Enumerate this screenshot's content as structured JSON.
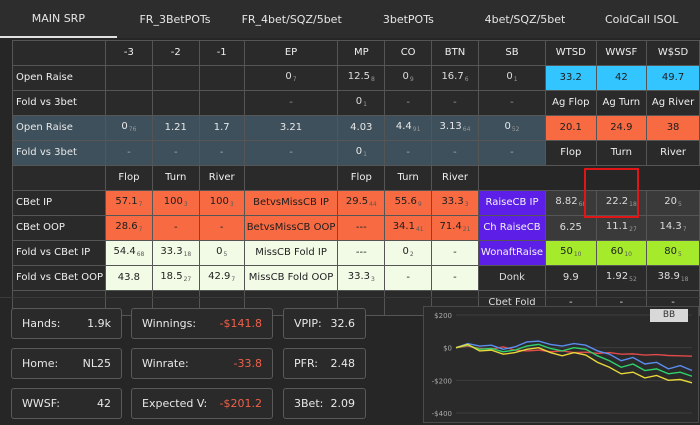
{
  "tabs": [
    "MAIN SRP",
    "FR_3BetPOTs",
    "FR_4bet/SQZ/5bet",
    "3betPOTs",
    "4bet/SQZ/5bet",
    "ColdCall ISOL"
  ],
  "positions_header": [
    "-3",
    "-2",
    "-1",
    "EP",
    "MP",
    "CO",
    "BTN",
    "SB"
  ],
  "showdown_header": [
    "WTSD",
    "WWSF",
    "W$SD"
  ],
  "showdown_values": [
    "33.2",
    "42",
    "49.7"
  ],
  "rows_top": [
    {
      "label": "Open Raise",
      "cells": [
        {
          "v": ""
        },
        {
          "v": ""
        },
        {
          "v": ""
        },
        {
          "v": "0",
          "s": "7"
        },
        {
          "v": "12.5",
          "s": "8"
        },
        {
          "v": "0",
          "s": "9"
        },
        {
          "v": "16.7",
          "s": "6"
        },
        {
          "v": "0",
          "s": "1"
        }
      ]
    },
    {
      "label": "Fold vs 3bet",
      "cells": [
        {
          "v": ""
        },
        {
          "v": ""
        },
        {
          "v": ""
        },
        {
          "v": "-"
        },
        {
          "v": "0",
          "s": "1"
        },
        {
          "v": "-"
        },
        {
          "v": "-"
        },
        {
          "v": "-"
        }
      ]
    },
    {
      "label": "Open Raise",
      "cells": [
        {
          "v": "0",
          "s": "76"
        },
        {
          "v": "1.21"
        },
        {
          "v": "1.7"
        },
        {
          "v": "3.21"
        },
        {
          "v": "4.03"
        },
        {
          "v": "4.4",
          "s": "91"
        },
        {
          "v": "3.13",
          "s": "64"
        },
        {
          "v": "0",
          "s": "52"
        }
      ]
    },
    {
      "label": "Fold vs 3bet",
      "cells": [
        {
          "v": "-"
        },
        {
          "v": "-"
        },
        {
          "v": "-"
        },
        {
          "v": "-"
        },
        {
          "v": "0",
          "s": "1"
        },
        {
          "v": "-"
        },
        {
          "v": "-"
        },
        {
          "v": "-"
        }
      ]
    }
  ],
  "aggression_header": [
    "Ag Flop",
    "Ag Turn",
    "Ag River"
  ],
  "aggression_values": [
    "20.1",
    "24.9",
    "38"
  ],
  "street_header": [
    "Flop",
    "Turn",
    "River"
  ],
  "cbet_section": {
    "header": [
      "Flop",
      "Turn",
      "River",
      "Flop",
      "Turn",
      "River"
    ],
    "rows": [
      {
        "label": "CBet IP",
        "left": [
          {
            "v": "57.1",
            "s": "7"
          },
          {
            "v": "100",
            "s": "3"
          },
          {
            "v": "100",
            "s": "3"
          }
        ],
        "mid_label": "BetvsMissCB IP",
        "mid": [
          {
            "v": "29.5",
            "s": "44"
          },
          {
            "v": "55.6",
            "s": "9"
          },
          {
            "v": "33.3",
            "s": "3"
          }
        ],
        "right_label": "RaiseCB IP",
        "right": [
          {
            "v": "8.82",
            "s": "68"
          },
          {
            "v": "22.2",
            "s": "18"
          },
          {
            "v": "20",
            "s": "5"
          }
        ]
      },
      {
        "label": "CBet OOP",
        "left": [
          {
            "v": "28.6",
            "s": "7"
          },
          {
            "v": "-"
          },
          {
            "v": "-"
          }
        ],
        "mid_label": "BetvsMissCB OOP",
        "mid": [
          {
            "v": "---"
          },
          {
            "v": "34.1",
            "s": "41"
          },
          {
            "v": "71.4",
            "s": "21"
          }
        ],
        "right_label": "Ch RaiseCB",
        "right": [
          {
            "v": "6.25"
          },
          {
            "v": "11.1",
            "s": "27"
          },
          {
            "v": "14.3",
            "s": "7"
          }
        ]
      },
      {
        "label": "Fold vs CBet IP",
        "left": [
          {
            "v": "54.4",
            "s": "68"
          },
          {
            "v": "33.3",
            "s": "18"
          },
          {
            "v": "0",
            "s": "5"
          }
        ],
        "mid_label": "MissCB Fold IP",
        "mid": [
          {
            "v": "---"
          },
          {
            "v": "0",
            "s": "2"
          },
          {
            "v": "-"
          }
        ],
        "right_label": "WonaftRaise",
        "right": [
          {
            "v": "50",
            "s": "10"
          },
          {
            "v": "60",
            "s": "10"
          },
          {
            "v": "80",
            "s": "5"
          }
        ]
      },
      {
        "label": "Fold vs CBet OOP",
        "left": [
          {
            "v": "43.8"
          },
          {
            "v": "18.5",
            "s": "27"
          },
          {
            "v": "42.9",
            "s": "7"
          }
        ],
        "mid_label": "MissCB Fold OOP",
        "mid": [
          {
            "v": "33.3",
            "s": "3"
          },
          {
            "v": "-"
          },
          {
            "v": "-"
          }
        ],
        "right_label": "Donk",
        "right": [
          {
            "v": "9.9"
          },
          {
            "v": "1.92",
            "s": "52"
          },
          {
            "v": "38.9",
            "s": "18"
          }
        ]
      },
      {
        "label": "",
        "left": [],
        "mid_label": "",
        "mid": [],
        "right_label": "Cbet Fold",
        "right": [
          {
            "v": "-"
          },
          {
            "v": "-"
          },
          {
            "v": "-"
          }
        ]
      }
    ]
  },
  "stats": {
    "hands_label": "Hands:",
    "hands_value": "1.9k",
    "winnings_label": "Winnings:",
    "winnings_value": "-$141.8",
    "vpip_label": "VPIP:",
    "vpip_value": "32.6",
    "home_label": "Home:",
    "home_value": "NL25",
    "winrate_label": "Winrate:",
    "winrate_value": "-33.8",
    "pfr_label": "PFR:",
    "pfr_value": "2.48",
    "wwsf_label": "WWSF:",
    "wwsf_value": "42",
    "ev_label": "Expected V:",
    "ev_value": "-$201.2",
    "threebet_label": "3Bet:",
    "threebet_value": "2.09"
  },
  "chart": {
    "y_ticks": [
      "$200",
      "$0",
      "-$200",
      "-$400"
    ],
    "badge": "BB"
  },
  "chart_data": {
    "type": "line",
    "ylim": [
      -400,
      200
    ],
    "y_ticks": [
      200,
      0,
      -200,
      -400
    ],
    "x": [
      0,
      5,
      10,
      15,
      20,
      25,
      30,
      35,
      40,
      45,
      50,
      55,
      60,
      65,
      70,
      75,
      80,
      85,
      90,
      95,
      100
    ],
    "series": [
      {
        "color": "#e04a4a",
        "values": [
          0,
          10,
          -5,
          -10,
          5,
          -15,
          -20,
          -15,
          -25,
          -20,
          -30,
          -28,
          -35,
          -30,
          -40,
          -38,
          -45,
          -42,
          -48,
          -50,
          -52
        ]
      },
      {
        "color": "#5a8df0",
        "values": [
          0,
          25,
          10,
          15,
          -10,
          5,
          35,
          40,
          20,
          10,
          25,
          15,
          -20,
          -40,
          -80,
          -60,
          -100,
          -90,
          -130,
          -110,
          -140
        ]
      },
      {
        "color": "#2ed36b",
        "values": [
          0,
          15,
          -10,
          -5,
          -25,
          -15,
          10,
          20,
          -5,
          -20,
          0,
          -10,
          -50,
          -80,
          -120,
          -100,
          -140,
          -130,
          -160,
          -150,
          -175
        ]
      },
      {
        "color": "#e8d83a",
        "values": [
          0,
          20,
          -20,
          -15,
          -40,
          -30,
          -10,
          0,
          -30,
          -50,
          -30,
          -45,
          -90,
          -120,
          -160,
          -150,
          -185,
          -170,
          -200,
          -195,
          -215
        ]
      }
    ]
  }
}
